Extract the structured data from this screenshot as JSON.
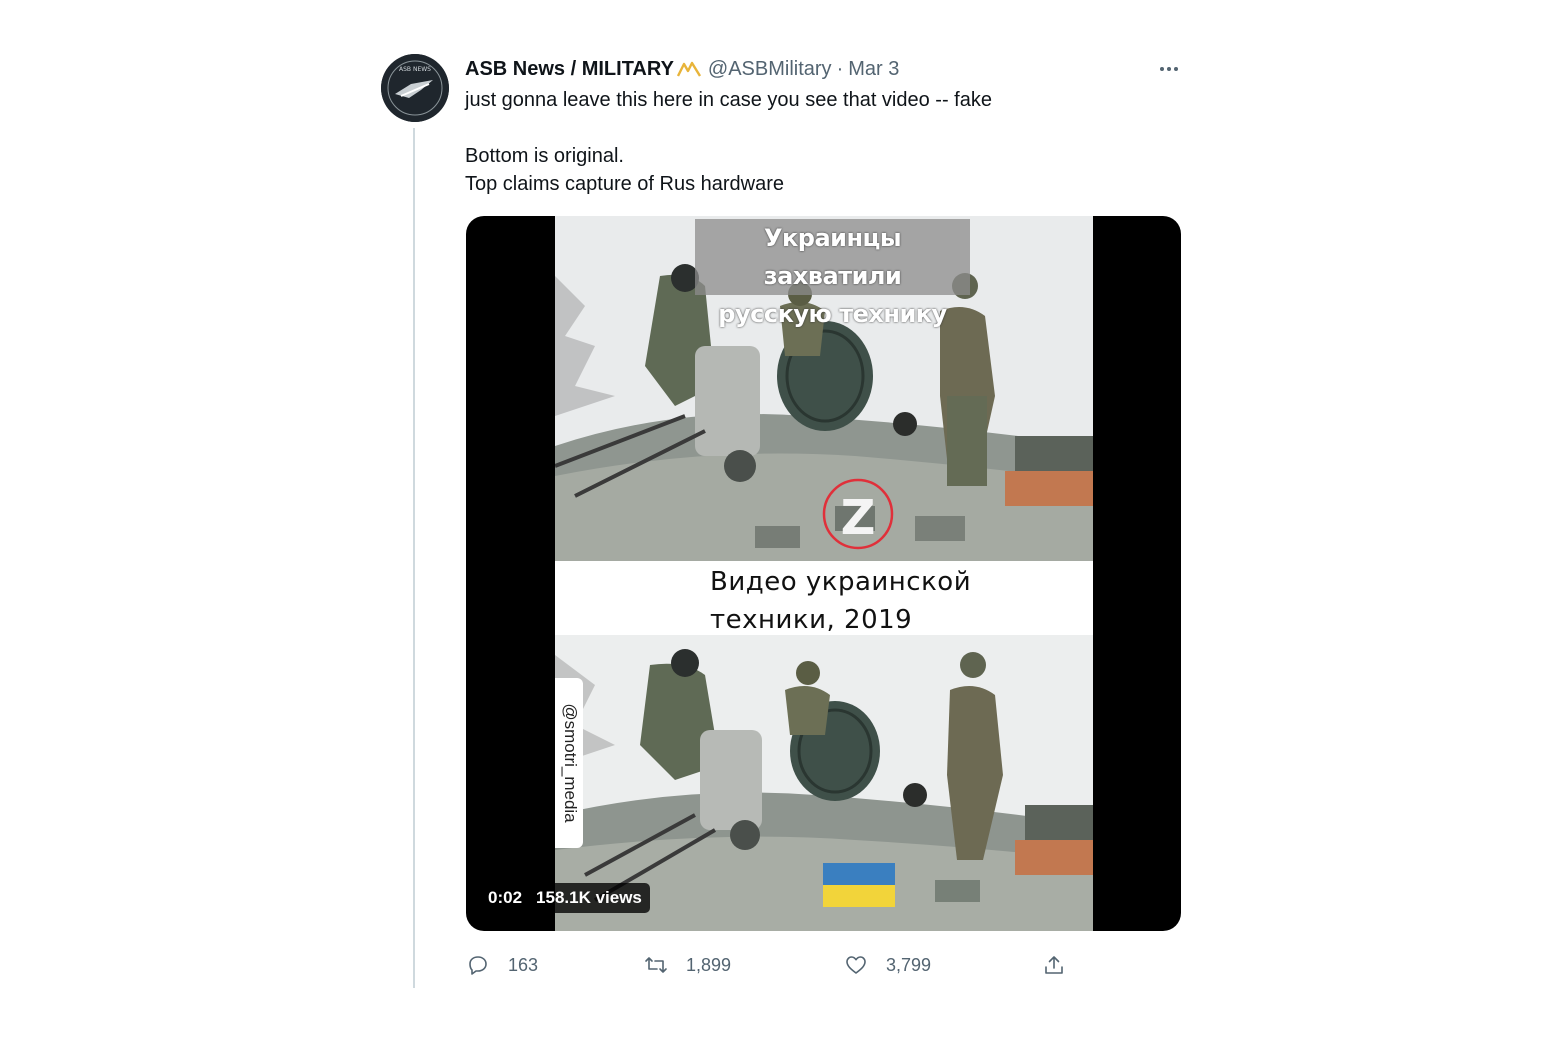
{
  "tweet": {
    "author": {
      "display_name": "ASB News / MILITARY",
      "handle": "@ASBMilitary",
      "verified_badge_icon": "gold-badge-icon",
      "avatar_icon": "news-logo-avatar"
    },
    "separator": "·",
    "date": "Mar 3",
    "more_icon": "ellipsis-icon",
    "text_lines": [
      "just gonna leave this here in case you see that video -- fake",
      "",
      "Bottom is original.",
      "Top claims capture of Rus hardware"
    ]
  },
  "media": {
    "caption_top_line1": "Украинцы захватили",
    "caption_top_line2": "русскую технику",
    "caption_bottom_line1": "Видео украинской",
    "caption_bottom_line2": "техники, 2019",
    "watermark": "@smotri_media",
    "elapsed_time": "0:02",
    "views": "158.1K views",
    "marking_top": "Z"
  },
  "actions": {
    "reply": {
      "icon": "reply-icon",
      "count": "163"
    },
    "retweet": {
      "icon": "retweet-icon",
      "count": "1,899"
    },
    "like": {
      "icon": "heart-icon",
      "count": "3,799"
    },
    "share": {
      "icon": "share-icon"
    }
  },
  "colors": {
    "text_primary": "#0f1419",
    "text_secondary": "#536471",
    "thread_line": "#cfd9de",
    "badge_gold": "#e8b43a",
    "media_background": "#000000",
    "ukraine_blue": "#3a7fc0",
    "ukraine_yellow": "#f2d43a"
  }
}
